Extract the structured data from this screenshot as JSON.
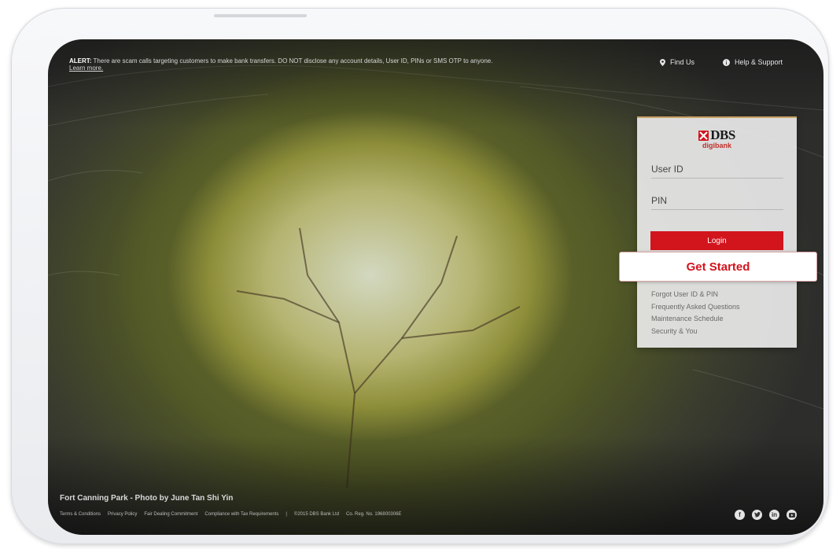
{
  "alert": {
    "prefix": "ALERT:",
    "text": "There are scam calls targeting customers to make bank transfers. DO NOT disclose any account details, User ID, PINs or SMS OTP to anyone.",
    "link": "Learn more."
  },
  "topnav": {
    "find_us": "Find Us",
    "help": "Help & Support"
  },
  "login": {
    "brand": "DBS",
    "brand_sub": "digibank",
    "user_id_placeholder": "User ID",
    "pin_placeholder": "PIN",
    "login_label": "Login",
    "get_started_label": "Get Started",
    "links": [
      "Forgot User ID & PIN",
      "Frequently Asked Questions",
      "Maintenance Schedule",
      "Security & You"
    ]
  },
  "photo_credit": "Fort Canning Park - Photo by June Tan Shi Yin",
  "footer": {
    "terms": "Terms & Conditions",
    "privacy": "Privacy Policy",
    "fair": "Fair Dealing Commitment",
    "tax": "Compliance with Tax Requirements",
    "sep": "|",
    "copyright": "©2015 DBS Bank Ltd",
    "reg": "Co. Reg. No. 196800306E"
  },
  "social": [
    "facebook-icon",
    "twitter-icon",
    "linkedin-icon",
    "youtube-icon"
  ],
  "colors": {
    "accent": "#d2141d",
    "card_border": "#c8a064"
  }
}
